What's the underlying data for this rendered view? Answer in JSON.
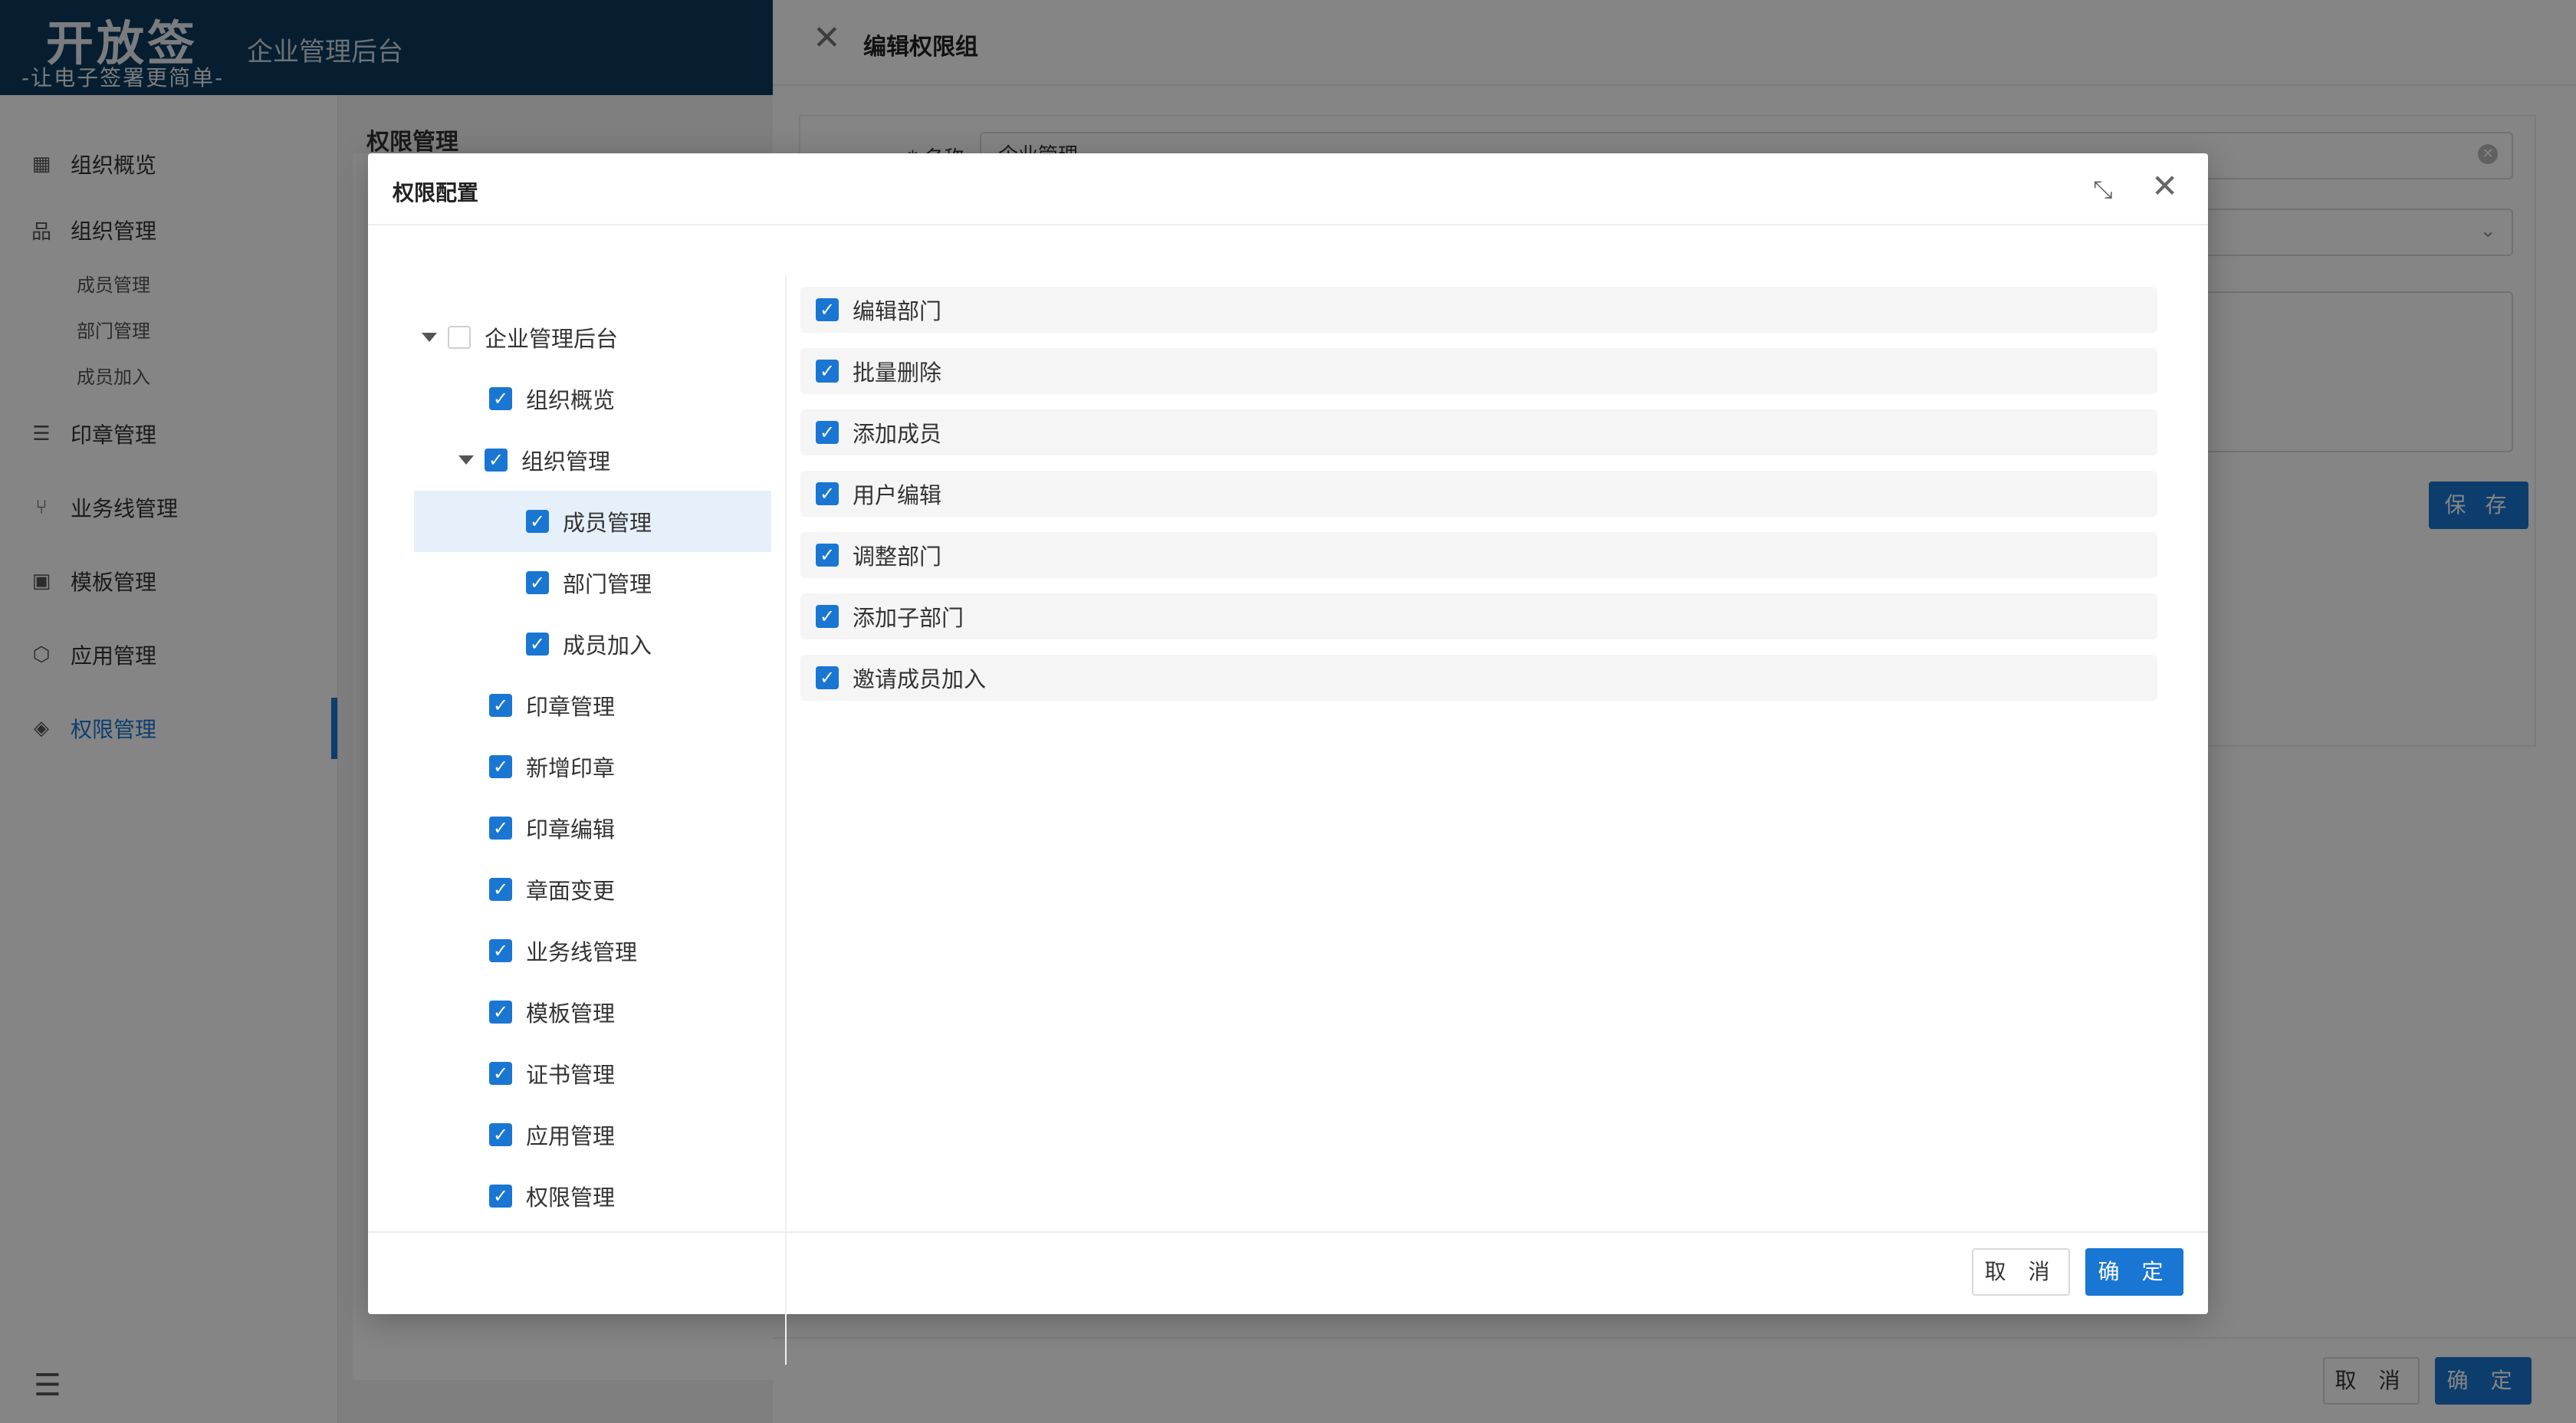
{
  "app": {
    "logo_main": "开放签",
    "logo_sub": "-让电子签署更简单-",
    "title": "企业管理后台"
  },
  "sidebar": {
    "items": [
      {
        "label": "组织概览",
        "icon": "grid-icon"
      },
      {
        "label": "组织管理",
        "icon": "org-tree-icon"
      },
      {
        "label": "印章管理",
        "icon": "list-icon"
      },
      {
        "label": "业务线管理",
        "icon": "branch-icon"
      },
      {
        "label": "模板管理",
        "icon": "template-icon"
      },
      {
        "label": "应用管理",
        "icon": "cube-icon"
      },
      {
        "label": "权限管理",
        "icon": "diamond-icon"
      }
    ],
    "sub_items": [
      "成员管理",
      "部门管理",
      "成员加入"
    ],
    "active": "权限管理"
  },
  "page": {
    "breadcrumb": "权限管理"
  },
  "drawer": {
    "title": "编辑权限组",
    "name_label": "* 名称",
    "name_value": "企业管理",
    "save_label": "保 存",
    "cancel_label": "取 消",
    "confirm_label": "确 定"
  },
  "modal": {
    "title": "权限配置",
    "tree": [
      {
        "label": "企业管理后台",
        "checked": false,
        "expanded": true
      },
      {
        "label": "组织概览",
        "checked": true
      },
      {
        "label": "组织管理",
        "checked": true,
        "expanded": true
      },
      {
        "label": "成员管理",
        "checked": true,
        "selected": true
      },
      {
        "label": "部门管理",
        "checked": true
      },
      {
        "label": "成员加入",
        "checked": true
      },
      {
        "label": "印章管理",
        "checked": true
      },
      {
        "label": "新增印章",
        "checked": true
      },
      {
        "label": "印章编辑",
        "checked": true
      },
      {
        "label": "章面变更",
        "checked": true
      },
      {
        "label": "业务线管理",
        "checked": true
      },
      {
        "label": "模板管理",
        "checked": true
      },
      {
        "label": "证书管理",
        "checked": true
      },
      {
        "label": "应用管理",
        "checked": true
      },
      {
        "label": "权限管理",
        "checked": true
      }
    ],
    "permissions": [
      {
        "label": "编辑部门",
        "checked": true
      },
      {
        "label": "批量删除",
        "checked": true
      },
      {
        "label": "添加成员",
        "checked": true
      },
      {
        "label": "用户编辑",
        "checked": true
      },
      {
        "label": "调整部门",
        "checked": true
      },
      {
        "label": "添加子部门",
        "checked": true
      },
      {
        "label": "邀请成员加入",
        "checked": true
      }
    ],
    "cancel_label": "取 消",
    "confirm_label": "确 定"
  },
  "colors": {
    "primary": "#1976d2",
    "topbar": "#0d3a5c",
    "mask": "rgba(0,0,0,0.48)"
  }
}
